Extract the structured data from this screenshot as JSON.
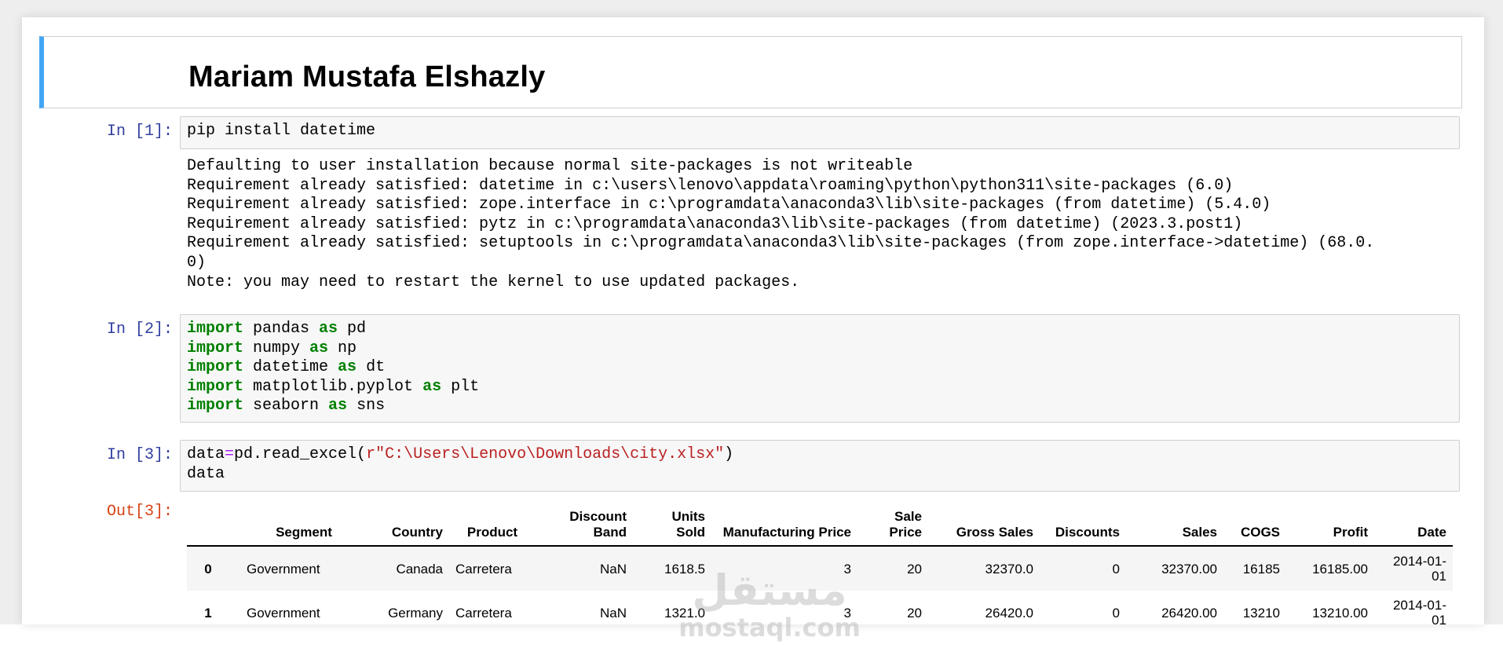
{
  "title": "Mariam Mustafa Elshazly",
  "cells": [
    {
      "prompt": "In [1]:",
      "code": "pip install datetime",
      "output": [
        "Defaulting to user installation because normal site-packages is not writeable",
        "Requirement already satisfied: datetime in c:\\users\\lenovo\\appdata\\roaming\\python\\python311\\site-packages (6.0)",
        "Requirement already satisfied: zope.interface in c:\\programdata\\anaconda3\\lib\\site-packages (from datetime) (5.4.0)",
        "Requirement already satisfied: pytz in c:\\programdata\\anaconda3\\lib\\site-packages (from datetime) (2023.3.post1)",
        "Requirement already satisfied: setuptools in c:\\programdata\\anaconda3\\lib\\site-packages (from zope.interface->datetime) (68.0.",
        "0)",
        "Note: you may need to restart the kernel to use updated packages."
      ]
    },
    {
      "prompt": "In [2]:",
      "lines": [
        {
          "kw": "import",
          "mod": " pandas ",
          "kw2": "as",
          "alias": " pd"
        },
        {
          "kw": "import",
          "mod": " numpy ",
          "kw2": "as",
          "alias": " np"
        },
        {
          "kw": "import",
          "mod": " datetime ",
          "kw2": "as",
          "alias": " dt"
        },
        {
          "kw": "import",
          "mod": " matplotlib.pyplot ",
          "kw2": "as",
          "alias": " plt"
        },
        {
          "kw": "import",
          "mod": " seaborn ",
          "kw2": "as",
          "alias": " sns"
        }
      ]
    },
    {
      "prompt": "In [3]:",
      "code_pre": "data",
      "code_op": "=",
      "code_mid": "pd.read_excel(",
      "code_str": "r\"C:\\Users\\Lenovo\\Downloads\\city.xlsx\"",
      "code_post": ")",
      "code_line2": "data",
      "out_prompt": "Out[3]:"
    }
  ],
  "table": {
    "headers": [
      "",
      "Segment",
      "Country",
      "Product",
      "Discount Band",
      "Units Sold",
      "Manufacturing Price",
      "Sale Price",
      "Gross Sales",
      "Discounts",
      "Sales",
      "COGS",
      "Profit",
      "Date"
    ],
    "rows": [
      [
        "0",
        "Government",
        "Canada",
        "Carretera",
        "NaN",
        "1618.5",
        "3",
        "20",
        "32370.0",
        "0",
        "32370.00",
        "16185",
        "16185.00",
        "2014-01-01"
      ],
      [
        "1",
        "Government",
        "Germany",
        "Carretera",
        "NaN",
        "1321.0",
        "3",
        "20",
        "26420.0",
        "0",
        "26420.00",
        "13210",
        "13210.00",
        "2014-01-01"
      ]
    ]
  },
  "watermark": {
    "arabic": "مستقل",
    "latin": "mostaql.com"
  }
}
